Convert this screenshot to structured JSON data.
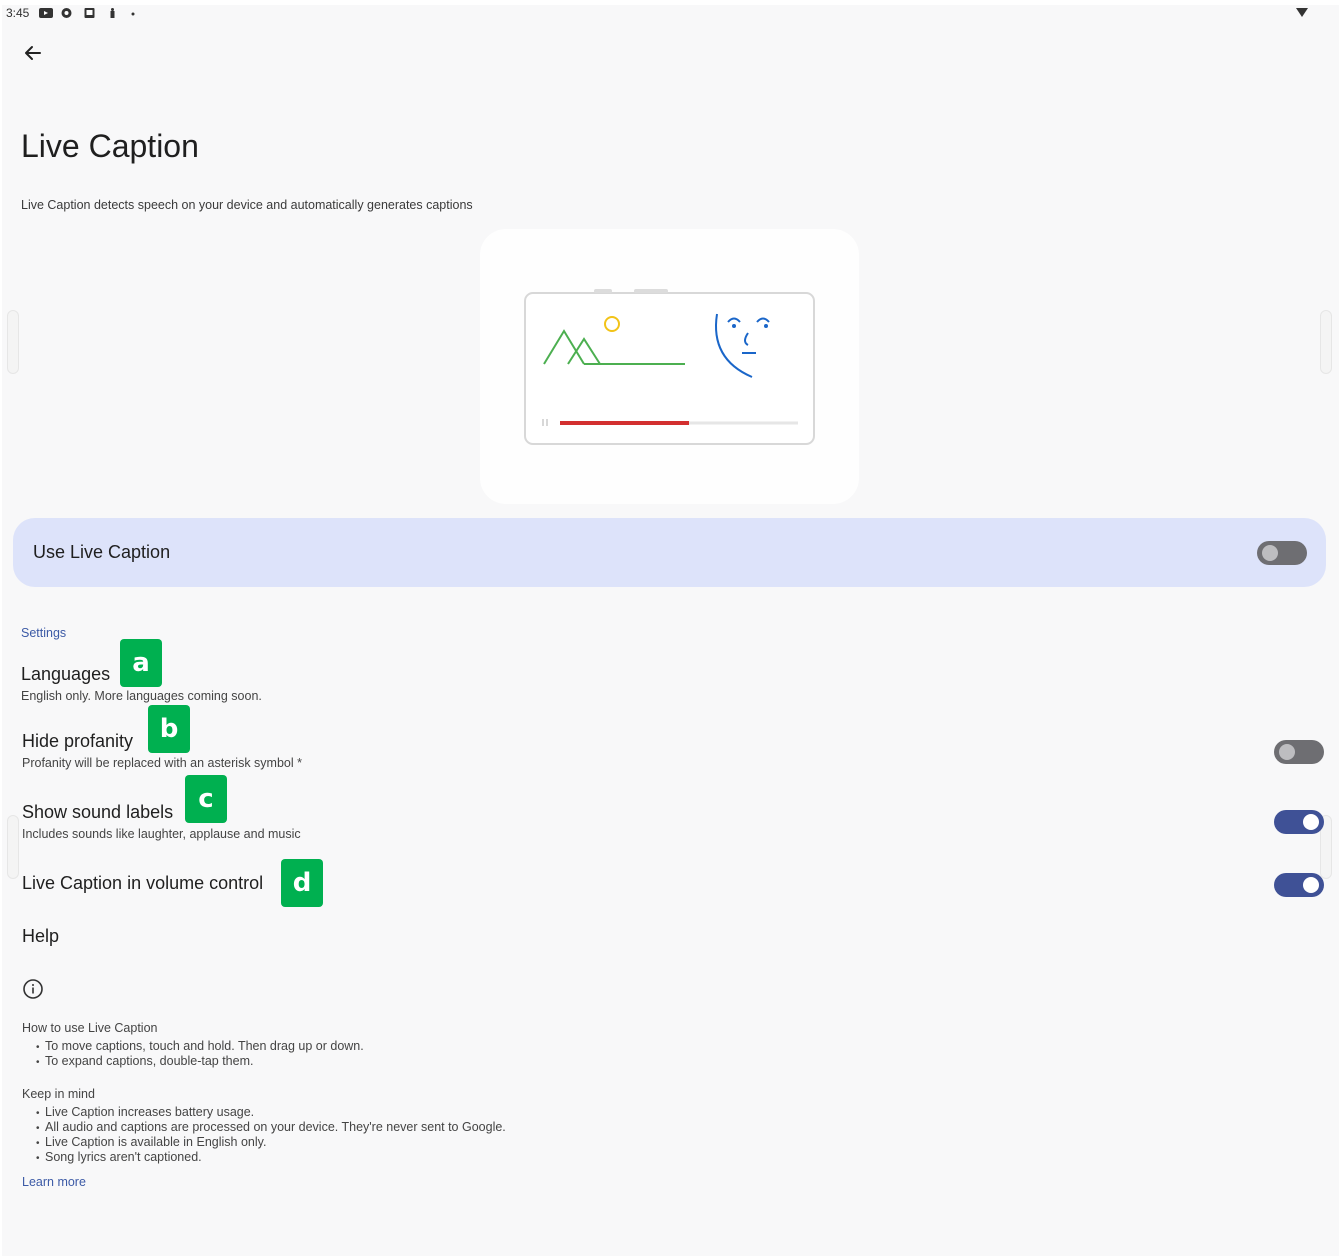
{
  "status_bar": {
    "time": "3:45",
    "icons": [
      "youtube-icon",
      "chrome-icon",
      "photo-icon",
      "accessibility-icon",
      "dot-icon",
      "wifi-icon"
    ]
  },
  "header": {
    "back_icon": "arrow-back-icon",
    "title": "Live Caption",
    "description": "Live Caption detects speech on your device and automatically generates captions"
  },
  "main_toggle": {
    "label": "Use Live Caption",
    "state": false
  },
  "settings": {
    "header": "Settings",
    "items": [
      {
        "title": "Languages",
        "subtitle": "English only. More languages coming soon.",
        "badge": "a"
      },
      {
        "title": "Hide profanity",
        "subtitle": "Profanity will be replaced with an asterisk symbol *",
        "badge": "b",
        "toggle": false
      },
      {
        "title": "Show sound labels",
        "subtitle": "Includes sounds like laughter, applause and music",
        "badge": "c",
        "toggle": true
      },
      {
        "title": "Live Caption in volume control",
        "badge": "d",
        "toggle": true
      }
    ]
  },
  "help": {
    "title": "Help",
    "info_icon": "info-icon",
    "how_to_heading": "How to use Live Caption",
    "how_to_items": [
      "To move captions, touch and hold. Then drag up or down.",
      "To expand captions, double-tap them."
    ],
    "keep_in_mind_heading": "Keep in mind",
    "keep_in_mind_items": [
      "Live Caption increases battery usage.",
      "All audio and captions are processed on your device. They're never sent to Google.",
      "Live Caption is available in English only.",
      "Song lyrics aren't captioned."
    ],
    "learn_more": "Learn more"
  },
  "colors": {
    "accent": "#3c5aa6",
    "toggle_card": "#dde3fa",
    "switch_on": "#3f5196",
    "badge": "#00b050",
    "illustration_green": "#4caf50",
    "illustration_yellow": "#f2c318",
    "illustration_blue": "#1a66c9",
    "illustration_red": "#d32f2f"
  }
}
